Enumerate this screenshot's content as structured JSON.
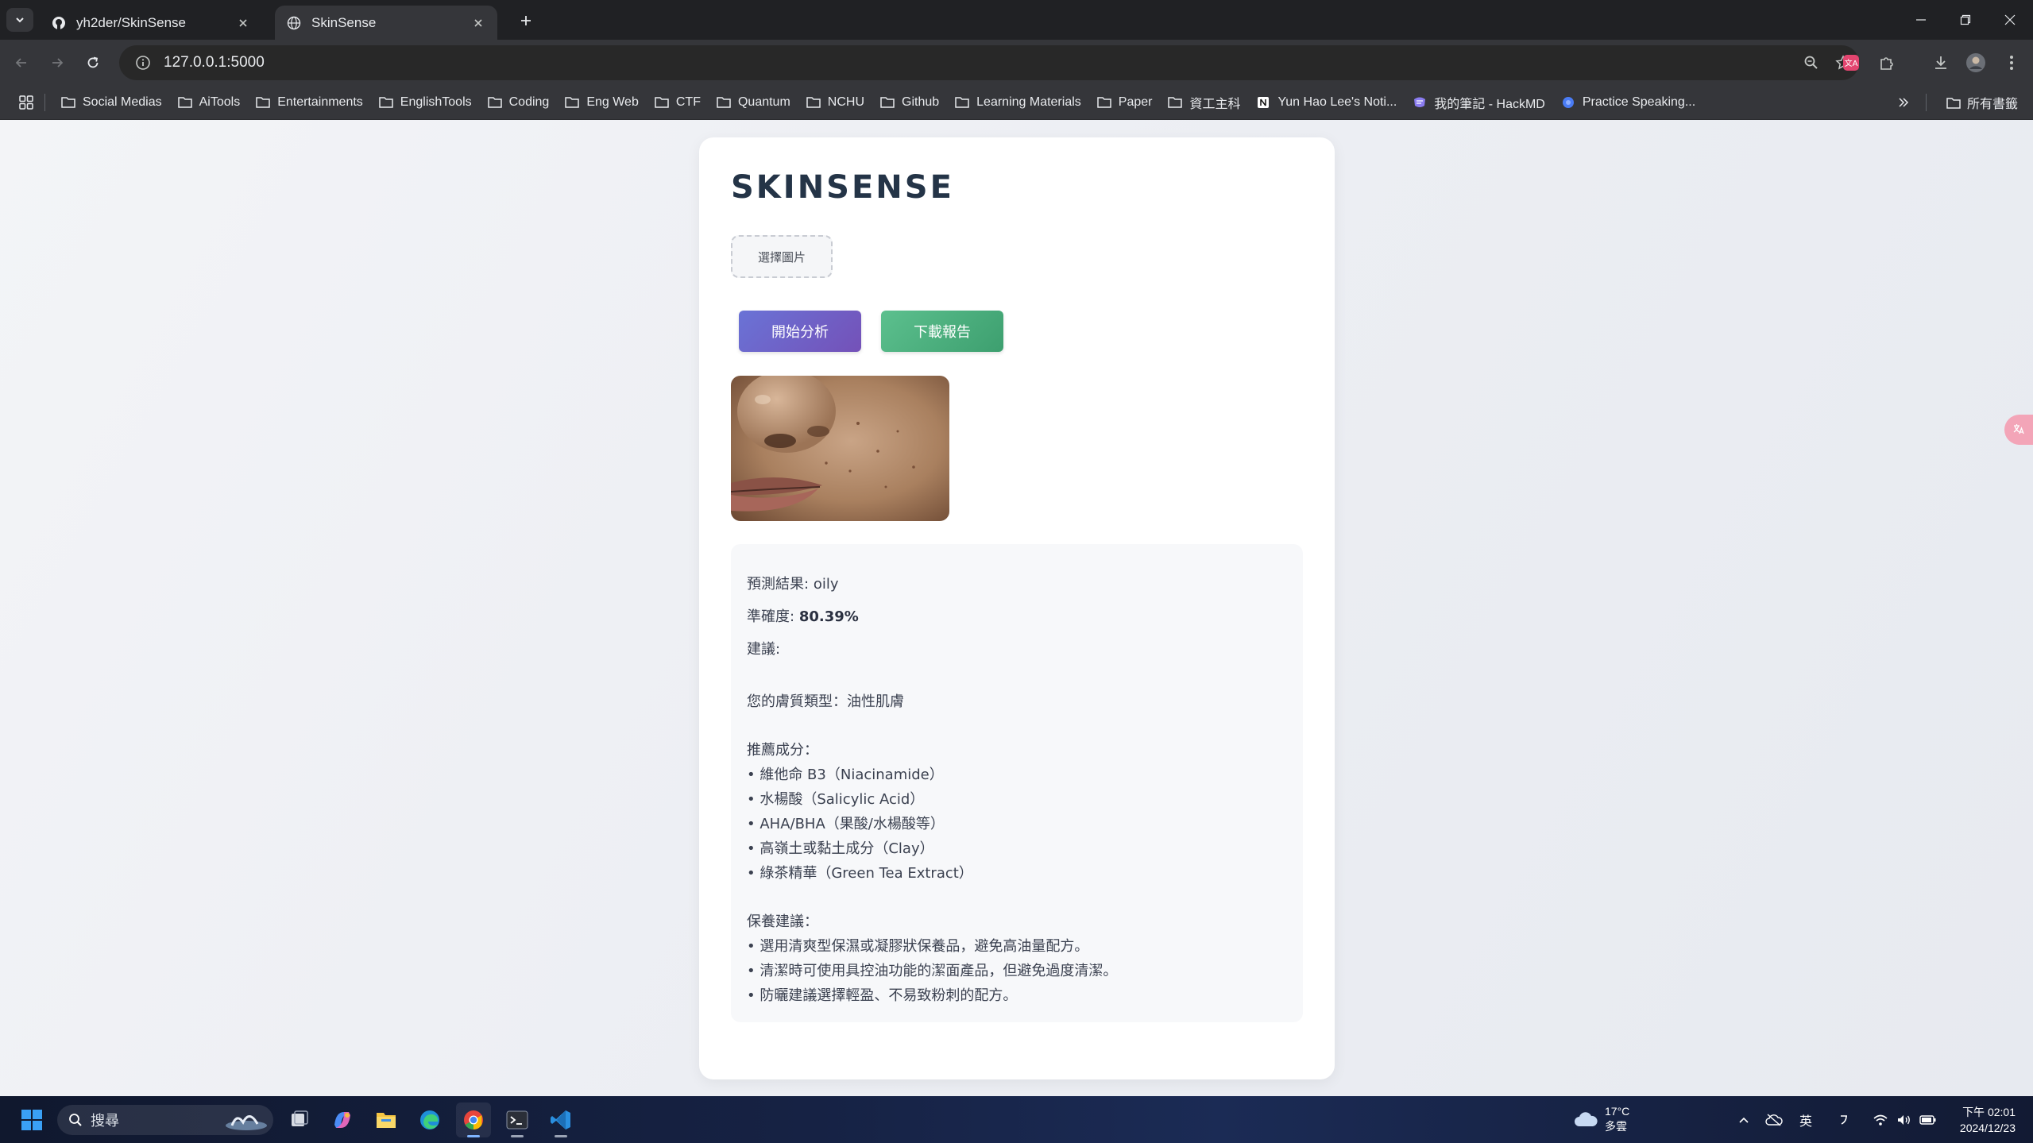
{
  "browser": {
    "tabs": [
      {
        "title": "yh2der/SkinSense",
        "favicon": "github-icon",
        "active": false
      },
      {
        "title": "SkinSense",
        "favicon": "globe-icon",
        "active": true
      }
    ],
    "url": "127.0.0.1:5000",
    "bookmarks": [
      {
        "label": "Social Medias",
        "icon": "folder-icon"
      },
      {
        "label": "AiTools",
        "icon": "folder-icon"
      },
      {
        "label": "Entertainments",
        "icon": "folder-icon"
      },
      {
        "label": "EnglishTools",
        "icon": "folder-icon"
      },
      {
        "label": "Coding",
        "icon": "folder-icon"
      },
      {
        "label": "Eng Web",
        "icon": "folder-icon"
      },
      {
        "label": "CTF",
        "icon": "folder-icon"
      },
      {
        "label": "Quantum",
        "icon": "folder-icon"
      },
      {
        "label": "NCHU",
        "icon": "folder-icon"
      },
      {
        "label": "Github",
        "icon": "folder-icon"
      },
      {
        "label": "Learning Materials",
        "icon": "folder-icon"
      },
      {
        "label": "Paper",
        "icon": "folder-icon"
      },
      {
        "label": "資工主科",
        "icon": "folder-icon"
      },
      {
        "label": "Yun Hao Lee's Noti...",
        "icon": "notion-icon"
      },
      {
        "label": "我的筆記 - HackMD",
        "icon": "hackmd-icon"
      },
      {
        "label": "Practice Speaking...",
        "icon": "globe-icon"
      }
    ],
    "all_bookmarks_label": "所有書籤"
  },
  "app": {
    "brand": "SKINSENSE",
    "choose_image_label": "選擇圖片",
    "analyze_label": "開始分析",
    "download_label": "下載報告",
    "result": {
      "prediction_label": "預測結果:",
      "prediction_value": "oily",
      "accuracy_label": "準確度:",
      "accuracy_value": "80.39%",
      "advice_label": "建議:",
      "skin_type_line": "您的膚質類型：油性肌膚",
      "ingredients_heading": "推薦成分：",
      "ingredients": [
        "• 維他命 B3（Niacinamide）",
        "• 水楊酸（Salicylic Acid）",
        "• AHA/BHA（果酸/水楊酸等）",
        "• 高嶺土或黏土成分（Clay）",
        "• 綠茶精華（Green Tea Extract）"
      ],
      "care_heading": "保養建議：",
      "care": [
        "• 選用清爽型保濕或凝膠狀保養品，避免高油量配方。",
        "• 清潔時可使用具控油功能的潔面產品，但避免過度清潔。",
        "• 防曬建議選擇輕盈、不易致粉刺的配方。"
      ]
    }
  },
  "taskbar": {
    "search_placeholder": "搜尋",
    "weather_temp": "17°C",
    "weather_desc": "多雲",
    "ime_label": "英",
    "time": "下午 02:01",
    "date": "2024/12/23"
  },
  "colors": {
    "analyze_button": "#6a73d6",
    "download_button": "#5cc08e",
    "brand_text": "#243447"
  }
}
